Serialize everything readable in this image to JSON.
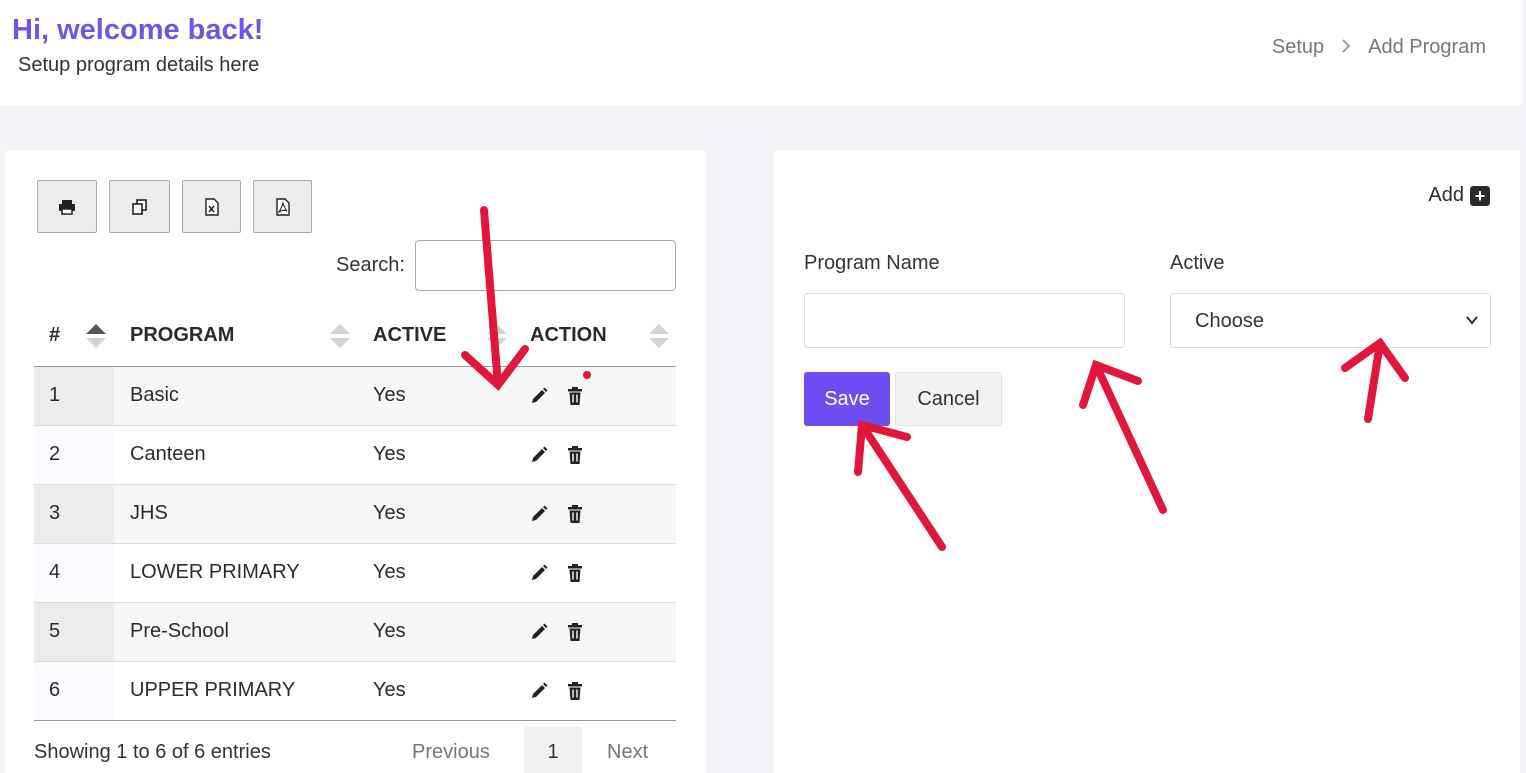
{
  "header": {
    "welcome": "Hi, welcome back!",
    "subtitle": "Setup program details here",
    "breadcrumb": [
      "Setup",
      "Add Program"
    ]
  },
  "toolbar": {
    "buttons": [
      "print-icon",
      "copy-icon",
      "excel-icon",
      "pdf-icon"
    ]
  },
  "search": {
    "label": "Search:",
    "value": ""
  },
  "table": {
    "columns": [
      "#",
      "PROGRAM",
      "ACTIVE",
      "ACTION"
    ],
    "rows": [
      {
        "num": "1",
        "program": "Basic",
        "active": "Yes"
      },
      {
        "num": "2",
        "program": "Canteen",
        "active": "Yes"
      },
      {
        "num": "3",
        "program": "JHS",
        "active": "Yes"
      },
      {
        "num": "4",
        "program": "LOWER PRIMARY",
        "active": "Yes"
      },
      {
        "num": "5",
        "program": "Pre-School",
        "active": "Yes"
      },
      {
        "num": "6",
        "program": "UPPER PRIMARY",
        "active": "Yes"
      }
    ],
    "action_icons": [
      "pencil-icon",
      "trash-icon"
    ]
  },
  "pagination": {
    "info": "Showing 1 to 6 of 6 entries",
    "previous": "Previous",
    "current": "1",
    "next": "Next"
  },
  "form": {
    "add_label": "Add",
    "program_name_label": "Program Name",
    "program_name_value": "",
    "active_label": "Active",
    "active_selected": "Choose",
    "save_label": "Save",
    "cancel_label": "Cancel"
  },
  "colors": {
    "accent": "#7352e8",
    "save_button": "#6d4cf0",
    "annotation_arrow": "#e0173a"
  }
}
